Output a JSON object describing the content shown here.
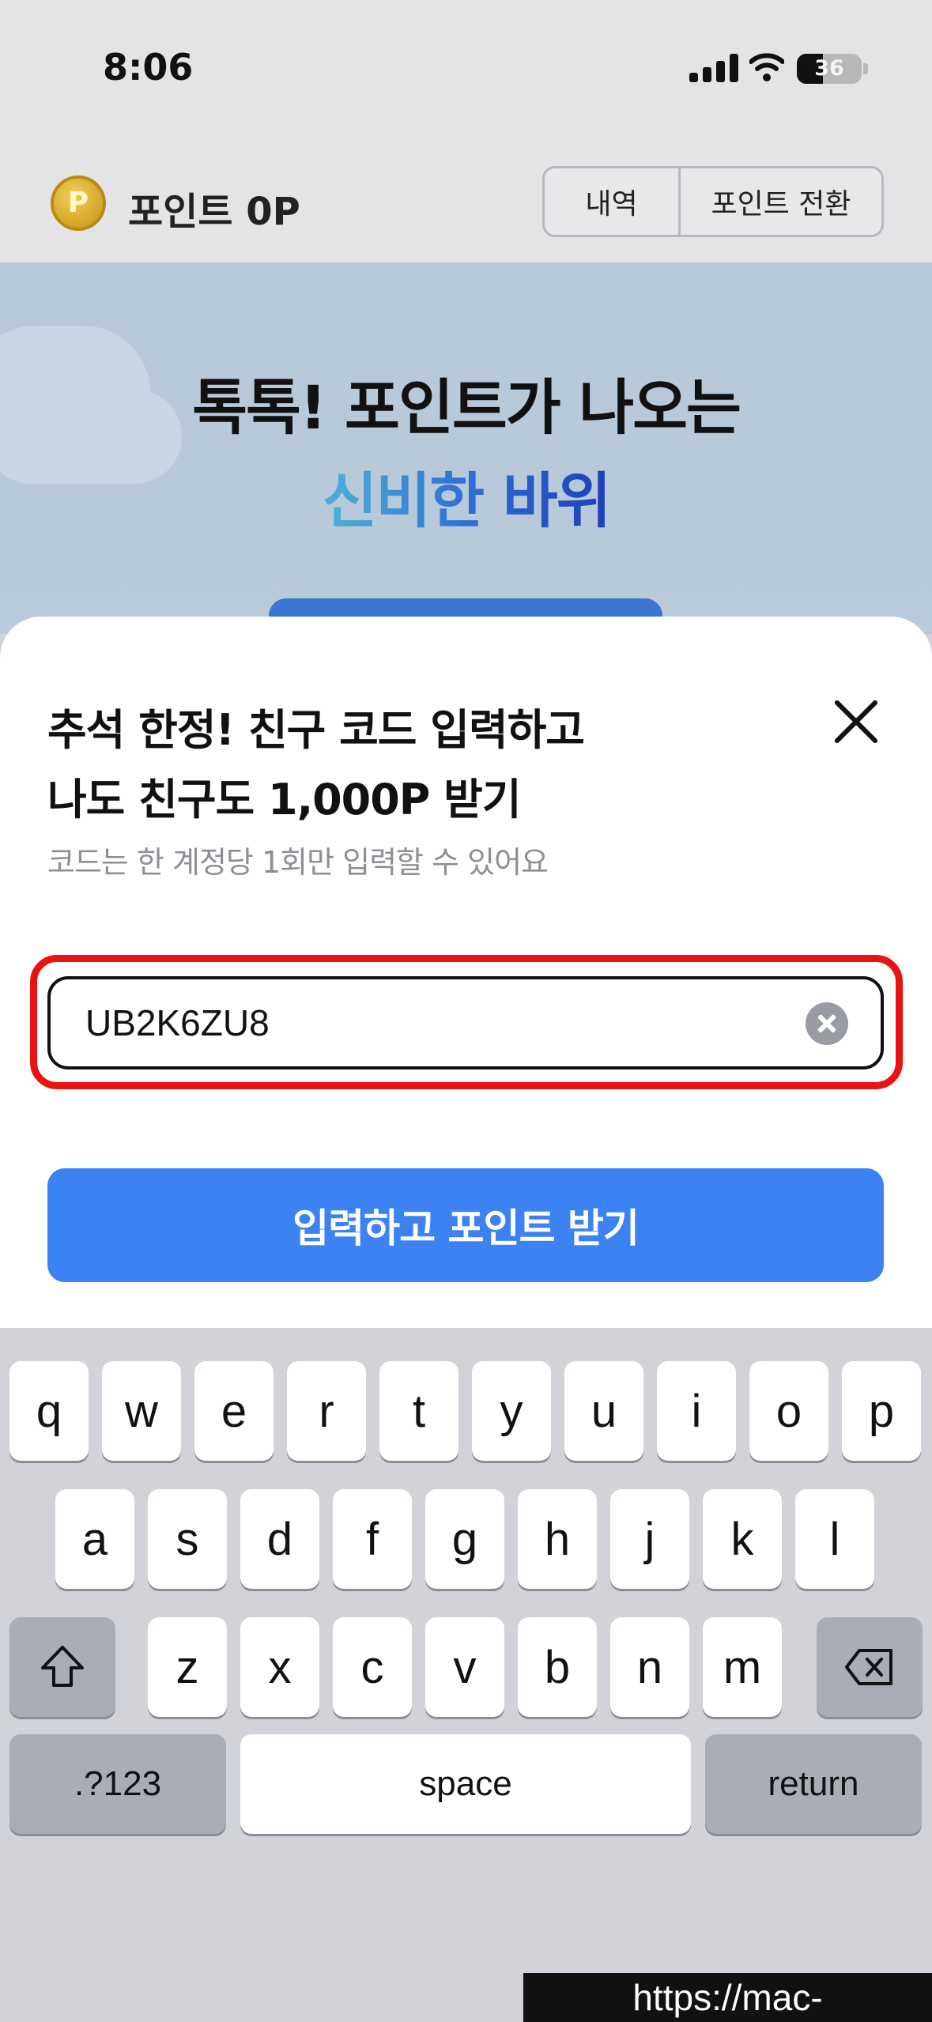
{
  "status_bar": {
    "time": "8:06",
    "battery": "36"
  },
  "points": {
    "label": "포인트",
    "value": "0P",
    "coin_letter": "P",
    "history_button": "내역",
    "convert_button": "포인트 전환"
  },
  "hero": {
    "title": "톡톡! 포인트가 나오는",
    "subtitle": "신비한 바위"
  },
  "sheet": {
    "title_line1": "추석 한정! 친구 코드 입력하고",
    "title_line2": "나도 친구도 1,000P 받기",
    "description": "코드는 한 계정당 1회만 입력할 수 있어요",
    "code_value": "UB2K6ZU8",
    "submit_label": "입력하고 포인트 받기"
  },
  "keyboard": {
    "row1": [
      "q",
      "w",
      "e",
      "r",
      "t",
      "y",
      "u",
      "i",
      "o",
      "p"
    ],
    "row2": [
      "a",
      "s",
      "d",
      "f",
      "g",
      "h",
      "j",
      "k",
      "l"
    ],
    "row3": [
      "z",
      "x",
      "c",
      "v",
      "b",
      "n",
      "m"
    ],
    "numbers_label": ".?123",
    "space_label": "space",
    "return_label": "return"
  },
  "watermark": "https://mac-os.tistory.com",
  "colors": {
    "accent": "#3c82f2",
    "highlight": "#ea1313",
    "hero_bg": "#b7c8d8"
  }
}
